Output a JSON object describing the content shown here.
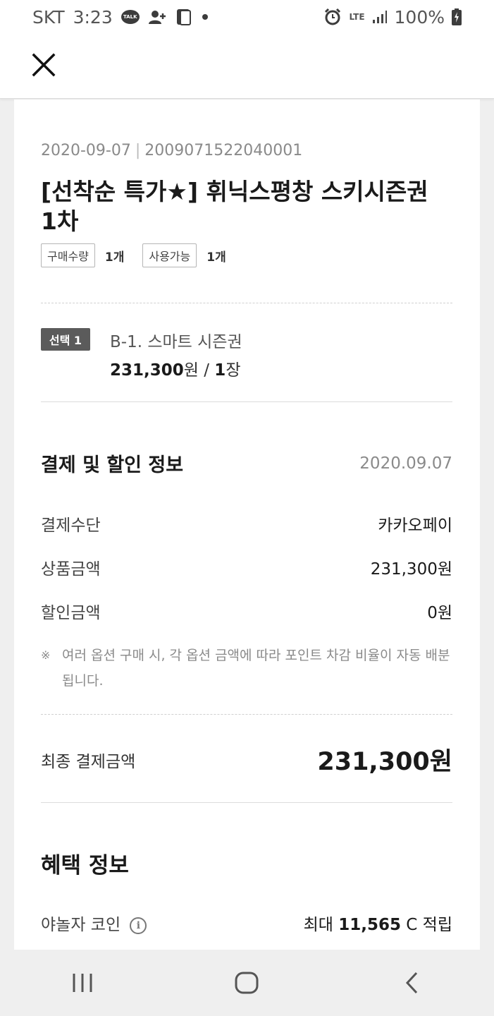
{
  "status_bar": {
    "carrier": "SKT",
    "time": "3:23",
    "talk_icon_text": "TALK",
    "network": "LTE",
    "battery": "100%"
  },
  "header": {
    "close_icon": "close-icon"
  },
  "order": {
    "date": "2020-09-07",
    "separator": "|",
    "order_number": "2009071522040001",
    "title": "[선착순 특가★] 휘닉스평창 스키시즌권 1차",
    "purchase_qty_label": "구매수량",
    "purchase_qty_value": "1개",
    "usable_label": "사용가능",
    "usable_value": "1개"
  },
  "option": {
    "badge": "선택 1",
    "name": "B-1. 스마트 시즌권",
    "price": "231,300",
    "price_unit": "원 / ",
    "qty": "1",
    "qty_unit": "장"
  },
  "payment": {
    "title": "결제 및 할인 정보",
    "date": "2020.09.07",
    "rows": [
      {
        "label": "결제수단",
        "value": "카카오페이"
      },
      {
        "label": "상품금액",
        "value": "231,300원"
      },
      {
        "label": "할인금액",
        "value": "0원"
      }
    ],
    "note_mark": "※",
    "note": "여러 옵션 구매 시, 각 옵션 금액에 따라 포인트 차감 비율이 자동 배분됩니다.",
    "final_label": "최종 결제금액",
    "final_value": "231,300원"
  },
  "benefit": {
    "title": "혜택 정보",
    "coin_label": "야놀자 코인",
    "coin_prefix": "최대 ",
    "coin_amount": "11,565",
    "coin_suffix": " C 적립"
  },
  "navbar": {
    "items": [
      "recent-apps",
      "home",
      "back"
    ]
  }
}
